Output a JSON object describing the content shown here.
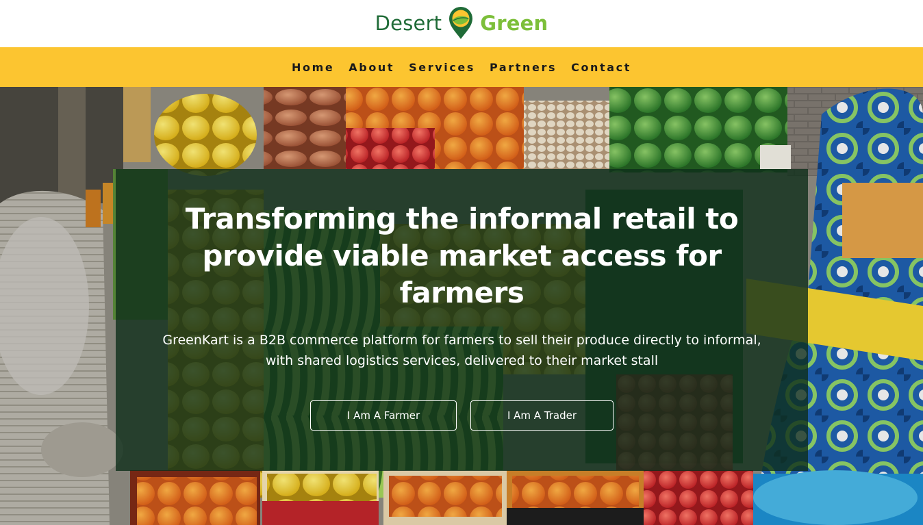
{
  "brand": {
    "name_part1": "Desert",
    "name_part2": "Green",
    "logo_icon": "map-pin-leaf-icon",
    "colors": {
      "dark_green": "#1f6b37",
      "light_green": "#7cbf3a",
      "nav_yellow": "#fcc530"
    }
  },
  "nav": {
    "items": [
      {
        "label": "Home"
      },
      {
        "label": "About"
      },
      {
        "label": "Services"
      },
      {
        "label": "Partners"
      },
      {
        "label": "Contact"
      }
    ]
  },
  "hero": {
    "headline_lines": [
      "Transforming the informal retail to",
      "provide viable market access for",
      "farmers"
    ],
    "subtext_lines": [
      "GreenKart is a B2B commerce platform for farmers to sell their produce directly to informal,",
      "with shared logistics services, delivered to their market stall"
    ],
    "buttons": {
      "farmer": "I Am A Farmer",
      "trader": "I Am A Trader"
    },
    "overlay_color": "#0e2e1a"
  }
}
